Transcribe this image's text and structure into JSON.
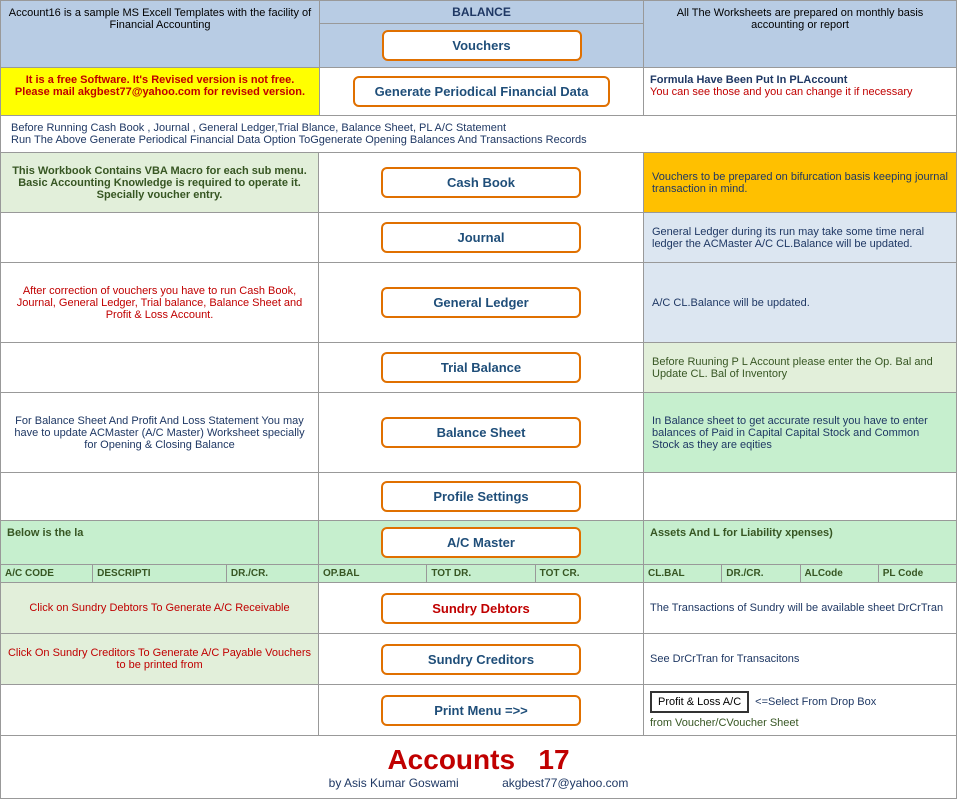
{
  "header": {
    "balance_label": "BALANCE",
    "left_text": "Account16 is a sample MS Excell Templates with the facility of Financial Accounting",
    "vouchers_btn": "Vouchers",
    "right_text": "All The Worksheets are prepared on monthly basis accounting or report"
  },
  "info": {
    "left_text": "It is a free Software. It's Revised version is not free.  Please mail akgbest77@yahoo.com for revised version.",
    "gen_btn": "Generate Periodical Financial Data",
    "right_title": "Formula Have Been Put In PLAccount",
    "right_text": "You can see those and you can change it if necessary"
  },
  "instructions": {
    "line1": "Before Running Cash Book , Journal , General Ledger,Trial Blance, Balance Sheet, PL A/C Statement",
    "line2": "Run The Above Generate Periodical Financial Data Option ToGgenerate Opening Balances And Transactions Records"
  },
  "rows": [
    {
      "left_text": "This Workbook Contains VBA Macro for each sub menu. Basic Accounting Knowledge is required to operate it. Specially voucher entry.",
      "left_color": "green-light",
      "left_text_color": "green-dark",
      "btn_label": "Cash Book",
      "right_text": "Vouchers to be prepared on bifurcation basis keeping journal transaction in mind.",
      "right_color": "orange"
    },
    {
      "left_text": "",
      "left_color": "white",
      "btn_label": "Journal",
      "right_text": "General Ledger during its run may take some time neral ledger the ACMaster A/C CL.Balance will be updated.",
      "right_color": "blue-light"
    },
    {
      "left_text": "After correction of vouchers you have to run Cash Book, Journal, General Ledger, Trial balance, Balance Sheet and Profit & Loss Account.",
      "left_color": "white",
      "left_text_color": "red",
      "btn_label": "General Ledger",
      "right_text": "A/C CL.Balance will be updated.",
      "right_color": "blue-light",
      "right_text2": ""
    },
    {
      "left_text": "",
      "left_color": "white",
      "btn_label": "Trial Balance",
      "right_text": "Before Ruuning P L Account please enter the Op. Bal and Update CL. Bal of Inventory",
      "right_color": "green-light"
    },
    {
      "left_text": "For Balance Sheet And Profit And Loss Statement You may have to update ACMaster (A/C Master) Worksheet specially for Opening & Closing Balance",
      "left_color": "white",
      "left_text_color": "blue-dark",
      "btn_label": "Balance Sheet",
      "right_text": "In Balance sheet to get accurate result you have to enter balances of Paid in Capital Capital Stock and Common Stock as they are eqities",
      "right_color": "green2"
    },
    {
      "left_text": "",
      "left_color": "white",
      "btn_label": "Profile Settings",
      "right_text": "",
      "right_color": "white"
    }
  ],
  "master_section": {
    "intro_left": "Below is the la",
    "intro_right": "Assets And L for Liability xpenses)",
    "acmaster_btn": "A/C Master",
    "headers": [
      "A/C CODE",
      "DESCRIPTI",
      "DR./CR.",
      "OP.BAL",
      "TOT DR.",
      "TOT CR.",
      "CL.BAL",
      "DR./CR.",
      "ALCode",
      "PL Code"
    ],
    "row1": {
      "left_text": "Click on Sundry Debtors To Generate A/C Receivable",
      "left_color": "green-light",
      "left_text_color": "red",
      "btn_label": "Sundry Debtors",
      "right_text": "The Transactions of Sundry will be available sheet DrCrTran"
    },
    "row2": {
      "left_text": "Click On Sundry Creditors To Generate A/C Payable Vouchers to be printed from",
      "left_color": "green-light",
      "left_text_color": "red",
      "btn_label": "Sundry Creditors",
      "right_text": "See DrCrTran for Transacitons"
    },
    "row3": {
      "left_text": "",
      "btn_label": "Print Menu =>>",
      "input_label": "Profit & Loss A/C",
      "input_hint": "<=Select From Drop Box",
      "right_text": "from Voucher/CVoucher Sheet"
    }
  },
  "footer": {
    "title": "Accounts",
    "number": "17",
    "author": "by Asis Kumar Goswami",
    "email": "akgbest77@yahoo.com"
  }
}
